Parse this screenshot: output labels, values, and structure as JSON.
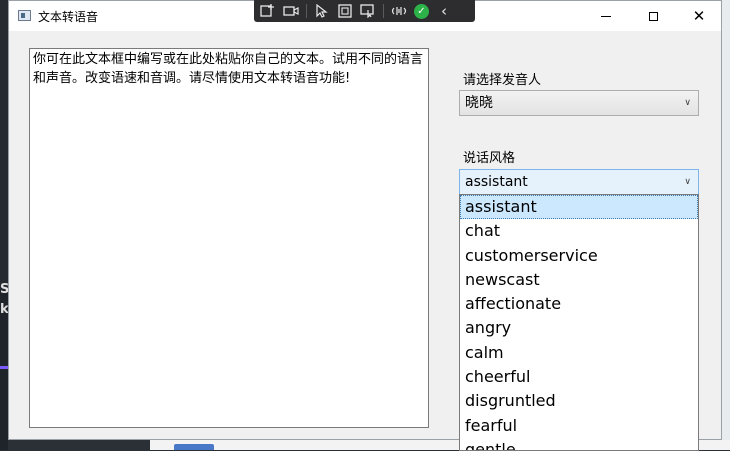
{
  "window": {
    "title": "文本转语音",
    "minimize_icon": "minimize-icon",
    "maximize_icon": "maximize-icon",
    "close_icon": "close-icon",
    "close_glyph": "✕"
  },
  "overlay_toolbar": {
    "icons": [
      "add-frame-icon",
      "video-icon",
      "select-cursor-icon",
      "region-icon",
      "window-select-icon",
      "audio-icon",
      "confirm-check-icon",
      "collapse-chevron-icon"
    ],
    "check_glyph": "✓",
    "chevron_glyph": "‹"
  },
  "editor": {
    "text": "你可在此文本框中编写或在此处粘贴你自己的文本。试用不同的语言和声音。改变语速和音调。请尽情使用文本转语音功能!"
  },
  "voice": {
    "label": "请选择发音人",
    "selected": "晓晓"
  },
  "style": {
    "label": "说话风格",
    "selected": "assistant",
    "options": [
      "assistant",
      "chat",
      "customerservice",
      "newscast",
      "affectionate",
      "angry",
      "calm",
      "cheerful",
      "disgruntled",
      "fearful",
      "gentle"
    ],
    "highlighted_index": 0
  },
  "background": {
    "side_text": "S\nk"
  }
}
